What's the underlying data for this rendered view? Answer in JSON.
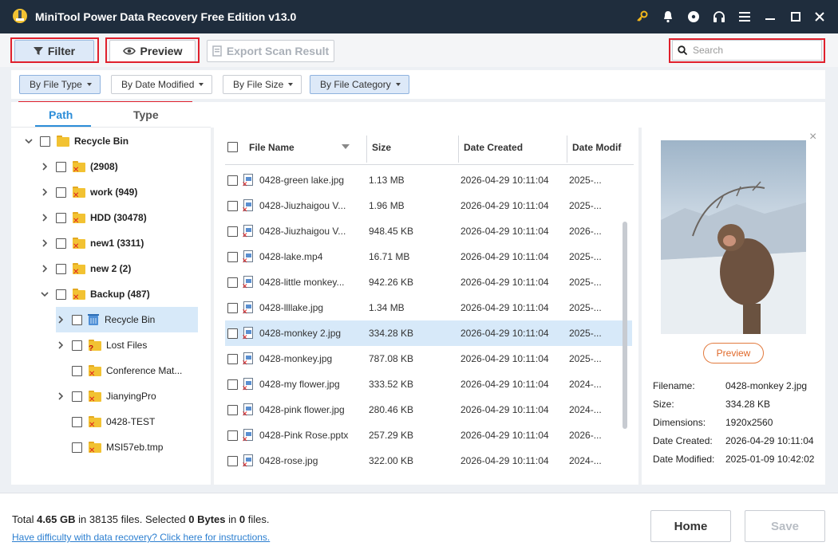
{
  "app": {
    "title": "MiniTool Power Data Recovery Free Edition v13.0"
  },
  "toolbar": {
    "filter_label": "Filter",
    "preview_label": "Preview",
    "export_label": "Export Scan Result",
    "search_placeholder": "Search"
  },
  "filters": {
    "by_file_type": "By File Type",
    "by_date_modified": "By Date Modified",
    "by_file_size": "By File Size",
    "by_file_category": "By File Category"
  },
  "tabs": {
    "path": "Path",
    "type": "Type"
  },
  "tree": [
    {
      "label": "Recycle Bin"
    },
    {
      "label": "(2908)"
    },
    {
      "label": "work (949)"
    },
    {
      "label": "HDD (30478)"
    },
    {
      "label": "new1 (3311)"
    },
    {
      "label": "new 2 (2)"
    },
    {
      "label": "Backup (487)"
    },
    {
      "label": "Recycle Bin"
    },
    {
      "label": "Lost Files"
    },
    {
      "label": "Conference Mat..."
    },
    {
      "label": "JianyingPro"
    },
    {
      "label": "0428-TEST"
    },
    {
      "label": "MSI57eb.tmp"
    }
  ],
  "list": {
    "headers": {
      "name": "File Name",
      "size": "Size",
      "created": "Date Created",
      "modified": "Date Modif"
    },
    "rows": [
      {
        "name": "0428-green lake.jpg",
        "size": "1.13 MB",
        "created": "2026-04-29 10:11:04",
        "modified": "2025-..."
      },
      {
        "name": "0428-Jiuzhaigou V...",
        "size": "1.96 MB",
        "created": "2026-04-29 10:11:04",
        "modified": "2025-..."
      },
      {
        "name": "0428-Jiuzhaigou V...",
        "size": "948.45 KB",
        "created": "2026-04-29 10:11:04",
        "modified": "2026-..."
      },
      {
        "name": "0428-lake.mp4",
        "size": "16.71 MB",
        "created": "2026-04-29 10:11:04",
        "modified": "2025-..."
      },
      {
        "name": "0428-little monkey...",
        "size": "942.26 KB",
        "created": "2026-04-29 10:11:04",
        "modified": "2025-..."
      },
      {
        "name": "0428-llllake.jpg",
        "size": "1.34 MB",
        "created": "2026-04-29 10:11:04",
        "modified": "2025-..."
      },
      {
        "name": "0428-monkey 2.jpg",
        "size": "334.28 KB",
        "created": "2026-04-29 10:11:04",
        "modified": "2025-..."
      },
      {
        "name": "0428-monkey.jpg",
        "size": "787.08 KB",
        "created": "2026-04-29 10:11:04",
        "modified": "2025-..."
      },
      {
        "name": "0428-my flower.jpg",
        "size": "333.52 KB",
        "created": "2026-04-29 10:11:04",
        "modified": "2024-..."
      },
      {
        "name": "0428-pink flower.jpg",
        "size": "280.46 KB",
        "created": "2026-04-29 10:11:04",
        "modified": "2024-..."
      },
      {
        "name": "0428-Pink Rose.pptx",
        "size": "257.29 KB",
        "created": "2026-04-29 10:11:04",
        "modified": "2026-..."
      },
      {
        "name": "0428-rose.jpg",
        "size": "322.00 KB",
        "created": "2026-04-29 10:11:04",
        "modified": "2024-..."
      }
    ]
  },
  "preview": {
    "button": "Preview",
    "labels": {
      "filename": "Filename:",
      "size": "Size:",
      "dimensions": "Dimensions:",
      "created": "Date Created:",
      "modified": "Date Modified:"
    },
    "values": {
      "filename": "0428-monkey 2.jpg",
      "size": "334.28 KB",
      "dimensions": "1920x2560",
      "created": "2026-04-29 10:11:04",
      "modified": "2025-01-09 10:42:02"
    }
  },
  "footer": {
    "total_label": "Total",
    "total_size": "4.65 GB",
    "in_label": "in",
    "total_files": "38135 files.",
    "selected_label": "Selected",
    "selected_size": "0 Bytes",
    "in_label2": "in",
    "selected_files": "0",
    "files_label": "files.",
    "help_link": "Have difficulty with data recovery? Click here for instructions.",
    "home_button": "Home",
    "save_button": "Save"
  }
}
